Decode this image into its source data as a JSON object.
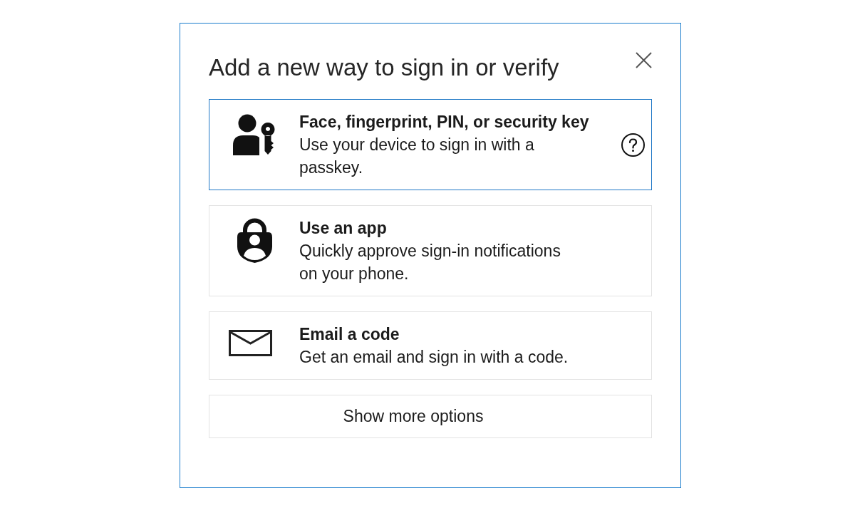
{
  "dialog": {
    "title": "Add a new way to sign in or verify"
  },
  "options": [
    {
      "kind": "passkey",
      "title": "Face, fingerprint, PIN, or security key",
      "description": "Use your device to sign in with a passkey.",
      "selected": true,
      "help": true
    },
    {
      "kind": "app",
      "title": "Use an app",
      "description": "Quickly approve sign-in notifications on your phone.",
      "selected": false,
      "help": false
    },
    {
      "kind": "email",
      "title": "Email a code",
      "description": "Get an email and sign in with a code.",
      "selected": false,
      "help": false
    }
  ],
  "more_button": {
    "label": "Show more options"
  }
}
